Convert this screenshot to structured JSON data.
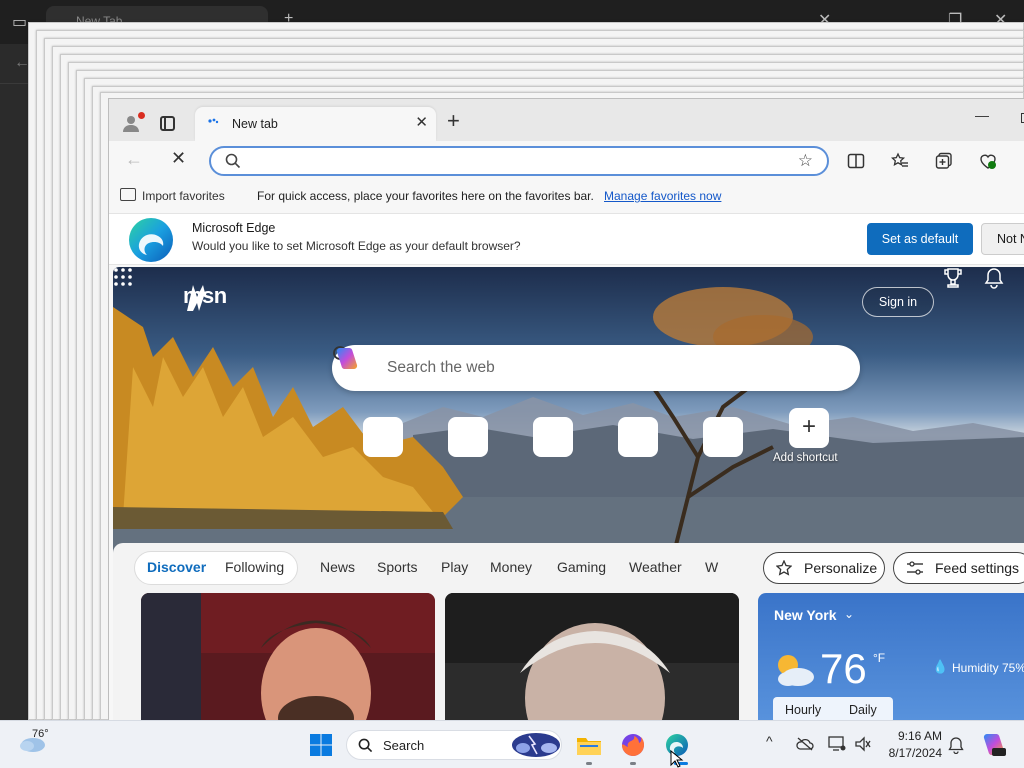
{
  "background_window": {
    "tab_title": "New Tab"
  },
  "tab": {
    "title": "New tab"
  },
  "favorites_bar": {
    "import_label": "Import favorites",
    "message": "For quick access, place your favorites here on the favorites bar.",
    "manage_link": "Manage favorites now"
  },
  "infobar": {
    "title": "Microsoft Edge",
    "message": "Would you like to set Microsoft Edge as your default browser?",
    "primary_button": "Set as default",
    "secondary_button": "Not N"
  },
  "msn": {
    "logo": "msn",
    "signin": "Sign in",
    "search_placeholder": "Search the web",
    "add_shortcut": "Add shortcut"
  },
  "feed": {
    "tabs": [
      "Discover",
      "Following",
      "News",
      "Sports",
      "Play",
      "Money",
      "Gaming",
      "Weather",
      "W"
    ],
    "personalize": "Personalize",
    "feed_settings": "Feed settings"
  },
  "weather": {
    "city": "New York",
    "temp": "76",
    "unit": "°F",
    "humidity": "Humidity 75%",
    "tabs": [
      "Hourly",
      "Daily"
    ]
  },
  "taskbar": {
    "weather_temp": "76°",
    "search_label": "Search",
    "time": "9:16 AM",
    "date": "8/17/2024"
  },
  "colors": {
    "accent": "#0f6cbd",
    "omnibox_border": "#5b8fd9",
    "weather_bg": "#3a74c9"
  }
}
